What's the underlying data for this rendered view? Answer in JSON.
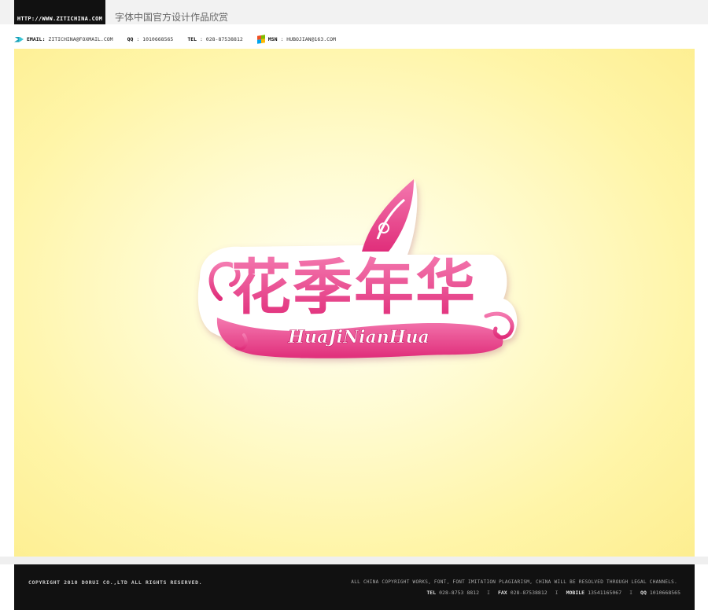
{
  "header": {
    "url": "HTTP://WWW.ZITICHINA.COM",
    "site_title": "字体中国官方设计作品欣赏"
  },
  "contact": {
    "email_label": "EMAIL:",
    "email_value": "ZITICHINA@FOXMAIL.COM",
    "qq_label": "QQ",
    "qq_value": ": 1010668565",
    "tel_label": "TEL",
    "tel_value": ": 028-87538812",
    "msn_label": "MSN",
    "msn_value": ": HUBOJIAN@163.COM"
  },
  "artwork": {
    "logo_chinese": "花季年华",
    "logo_pinyin": "HuaJiNianHua",
    "colors": {
      "logo_pink": "#e02d7a",
      "logo_pink_light": "#f47ab0",
      "logo_white": "#ffffff",
      "background_yellow": "#fff5a8"
    }
  },
  "footer": {
    "copyright": "COPYRIGHT 2010 DORUI CO.,LTD ALL RIGHTS RESERVED.",
    "legal_notice": "ALL CHINA COPYRIGHT WORKS, FONT, FONT IMITATION PLAGIARISM, CHINA WILL BE RESOLVED THROUGH LEGAL CHANNELS.",
    "tel_label": "TEL",
    "tel_value": "028-8753 8812",
    "fax_label": "FAX",
    "fax_value": "028-87538812",
    "mobile_label": "MOBILE",
    "mobile_value": "13541165067",
    "qq_label": "QQ",
    "qq_value": "1010668565",
    "separator": "I"
  }
}
